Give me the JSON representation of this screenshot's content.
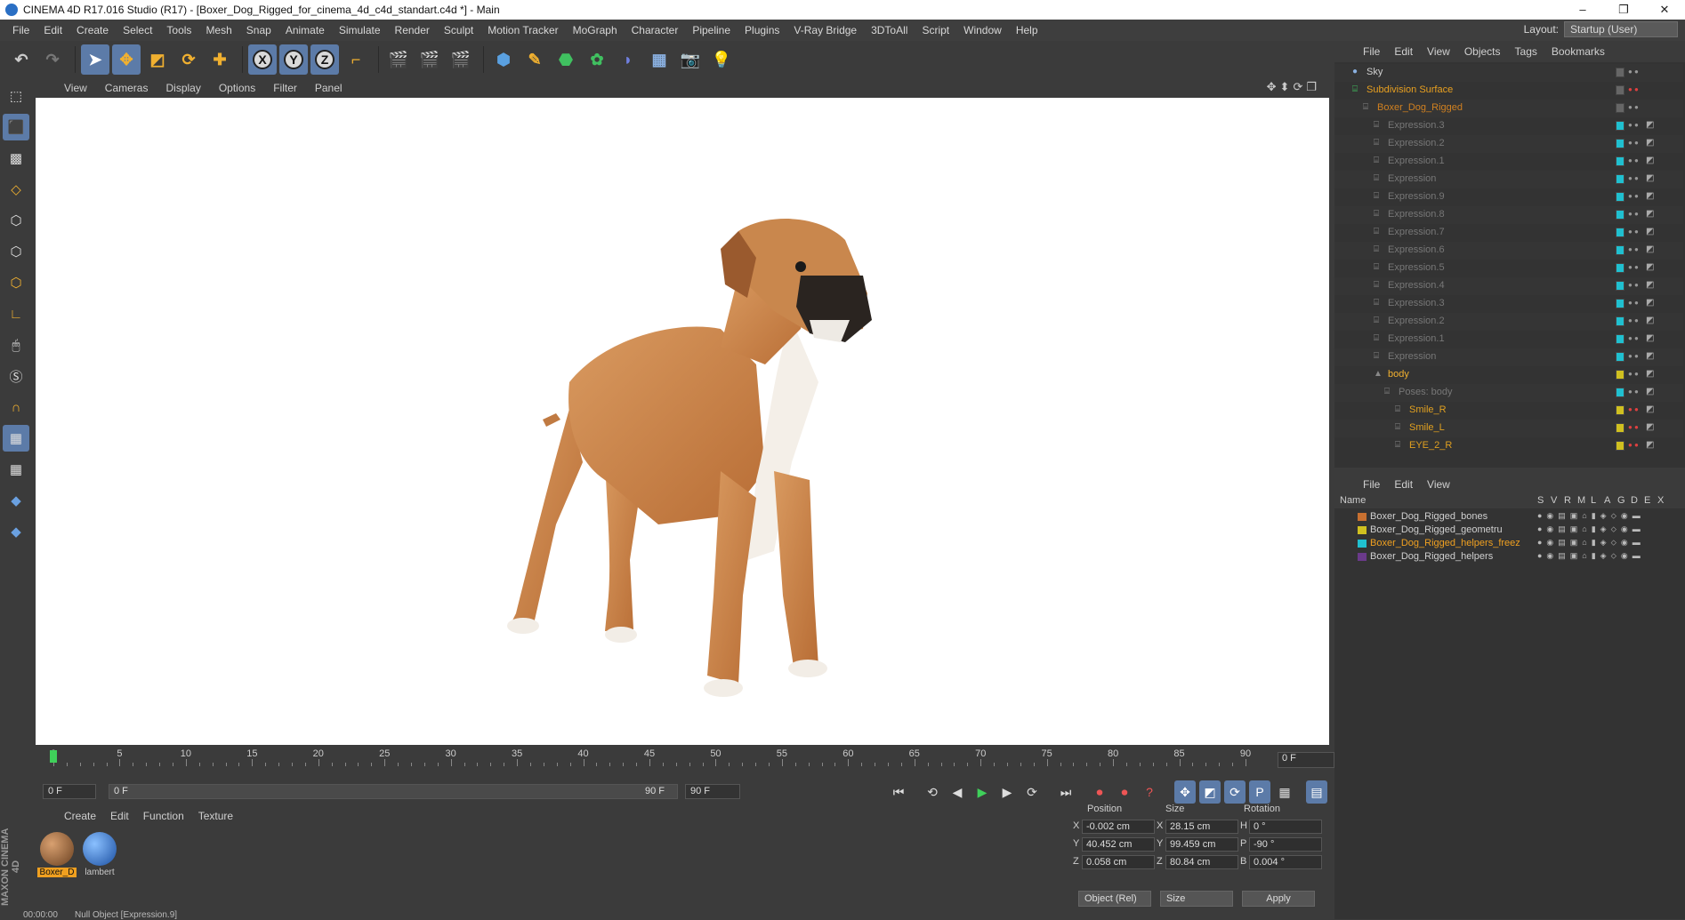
{
  "window": {
    "title": "CINEMA 4D R17.016 Studio (R17) - [Boxer_Dog_Rigged_for_cinema_4d_c4d_standart.c4d *] - Main"
  },
  "menubar": [
    "File",
    "Edit",
    "Create",
    "Select",
    "Tools",
    "Mesh",
    "Snap",
    "Animate",
    "Simulate",
    "Render",
    "Sculpt",
    "Motion Tracker",
    "MoGraph",
    "Character",
    "Pipeline",
    "Plugins",
    "V-Ray Bridge",
    "3DToAll",
    "Script",
    "Window",
    "Help"
  ],
  "layout": {
    "label": "Layout:",
    "value": "Startup (User)"
  },
  "viewport_menu": [
    "View",
    "Cameras",
    "Display",
    "Options",
    "Filter",
    "Panel"
  ],
  "timeline": {
    "ticks": [
      "0",
      "5",
      "10",
      "15",
      "20",
      "25",
      "30",
      "35",
      "40",
      "45",
      "50",
      "55",
      "60",
      "65",
      "70",
      "75",
      "80",
      "85",
      "90"
    ],
    "current_frame": "0 F"
  },
  "playbar": {
    "start": "0 F",
    "range_start": "0 F",
    "range_end": "90 F",
    "end": "90 F"
  },
  "material_menu": [
    "Create",
    "Edit",
    "Function",
    "Texture"
  ],
  "materials": [
    {
      "name": "Boxer_D",
      "color": "#a0704a"
    },
    {
      "name": "lambert",
      "color": "#2f6fc0"
    }
  ],
  "attributes": {
    "headers": {
      "position": "Position",
      "size": "Size",
      "rotation": "Rotation"
    },
    "rows": [
      {
        "axis": "X",
        "pos": "-0.002 cm",
        "size_axis": "X",
        "size": "28.15 cm",
        "rot_axis": "H",
        "rot": "0 °"
      },
      {
        "axis": "Y",
        "pos": "40.452 cm",
        "size_axis": "Y",
        "size": "99.459 cm",
        "rot_axis": "P",
        "rot": "-90 °"
      },
      {
        "axis": "Z",
        "pos": "0.058 cm",
        "size_axis": "Z",
        "size": "80.84 cm",
        "rot_axis": "B",
        "rot": "0.004 °"
      }
    ],
    "mode": "Object (Rel)",
    "size_mode": "Size",
    "apply": "Apply"
  },
  "statusbar": {
    "time": "00:00:00",
    "message": "Null Object [Expression.9]"
  },
  "brand": "MAXON CINEMA 4D",
  "object_manager": {
    "menu": [
      "File",
      "Edit",
      "View",
      "Objects",
      "Tags",
      "Bookmarks"
    ],
    "rows": [
      {
        "name": "Sky",
        "color": "#d0d0d0",
        "indent": 0
      },
      {
        "name": "Subdivision Surface",
        "color": "#e8a020",
        "indent": 0
      },
      {
        "name": "Boxer_Dog_Rigged",
        "color": "#d08020",
        "indent": 1
      },
      {
        "name": "Expression.3",
        "color": "#777777",
        "indent": 2
      },
      {
        "name": "Expression.2",
        "color": "#777777",
        "indent": 2
      },
      {
        "name": "Expression.1",
        "color": "#777777",
        "indent": 2
      },
      {
        "name": "Expression",
        "color": "#777777",
        "indent": 2
      },
      {
        "name": "Expression.9",
        "color": "#777777",
        "indent": 2
      },
      {
        "name": "Expression.8",
        "color": "#777777",
        "indent": 2
      },
      {
        "name": "Expression.7",
        "color": "#777777",
        "indent": 2
      },
      {
        "name": "Expression.6",
        "color": "#777777",
        "indent": 2
      },
      {
        "name": "Expression.5",
        "color": "#777777",
        "indent": 2
      },
      {
        "name": "Expression.4",
        "color": "#777777",
        "indent": 2
      },
      {
        "name": "Expression.3",
        "color": "#777777",
        "indent": 2
      },
      {
        "name": "Expression.2",
        "color": "#777777",
        "indent": 2
      },
      {
        "name": "Expression.1",
        "color": "#777777",
        "indent": 2
      },
      {
        "name": "Expression",
        "color": "#777777",
        "indent": 2
      },
      {
        "name": "body",
        "color": "#f0b030",
        "indent": 2
      },
      {
        "name": "Poses: body",
        "color": "#777777",
        "indent": 3
      },
      {
        "name": "Smile_R",
        "color": "#e0a020",
        "indent": 4
      },
      {
        "name": "Smile_L",
        "color": "#e0a020",
        "indent": 4
      },
      {
        "name": "EYE_2_R",
        "color": "#e0a020",
        "indent": 4
      }
    ]
  },
  "layer_manager": {
    "menu": [
      "File",
      "Edit",
      "View"
    ],
    "columns": [
      "Name",
      "S",
      "V",
      "R",
      "M",
      "L",
      "A",
      "G",
      "D",
      "E",
      "X"
    ],
    "layers": [
      {
        "name": "Boxer_Dog_Rigged_bones",
        "color": "#c87030",
        "text_color": "#d0d0d0"
      },
      {
        "name": "Boxer_Dog_Rigged_geometru",
        "color": "#d0c020",
        "text_color": "#d0d0d0"
      },
      {
        "name": "Boxer_Dog_Rigged_helpers_freez",
        "color": "#20c0d0",
        "text_color": "#f0a020"
      },
      {
        "name": "Boxer_Dog_Rigged_helpers",
        "color": "#6a3a8a",
        "text_color": "#d0d0d0"
      }
    ]
  }
}
